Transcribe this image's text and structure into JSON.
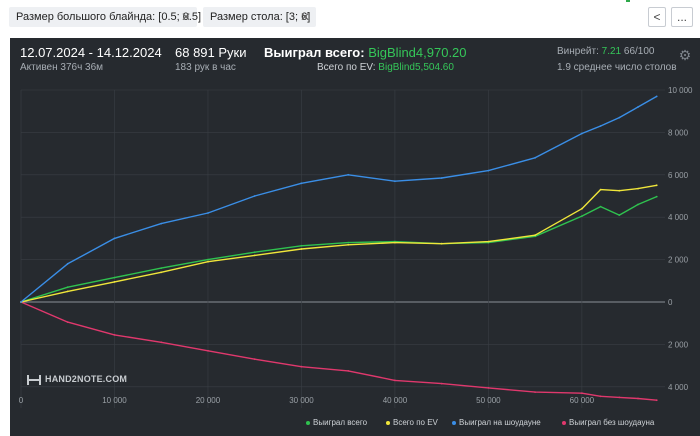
{
  "filters": [
    {
      "label": "Размер большого блайнда: [0.5; 0.5]",
      "close": "✕"
    },
    {
      "label": "Размер стола: [3; 6]",
      "close": "✕"
    }
  ],
  "nav": {
    "back": "<",
    "more": "..."
  },
  "summary": {
    "date_range": "12.07.2024 - 14.12.2024",
    "active": "Активен 376ч 36м",
    "hands": "68 891 Руки",
    "hands_per_hour": "183 рук в час",
    "won_total_label": "Выиграл всего:",
    "won_total_value": "BigBlind4,970.20",
    "ev_total_label": "Всего по EV:",
    "ev_total_value": "BigBlind5,504.60",
    "winrate_label": "Винрейт:",
    "winrate_value": "7.21",
    "winrate_per": "66/100",
    "avg_tables": "1.9 среднее число столов"
  },
  "logo_text": "HAND2NOTE.COM",
  "icons": {
    "settings": "gear-icon",
    "logo": "hand2note-logo-icon"
  },
  "colors": {
    "panel": "#262a2f",
    "green": "#2fc24f",
    "yellow": "#f0e63a",
    "blue": "#3a8ee6",
    "pink": "#e0386d"
  },
  "chart_data": {
    "type": "line",
    "x": [
      0,
      5000,
      10000,
      15000,
      20000,
      25000,
      30000,
      35000,
      40000,
      45000,
      50000,
      55000,
      60000,
      62000,
      64000,
      66000,
      68000
    ],
    "series": [
      {
        "name": "Выиграл всего",
        "values": [
          0,
          700,
          1150,
          1600,
          2000,
          2350,
          2650,
          2800,
          2850,
          2750,
          2800,
          3100,
          4050,
          4500,
          4100,
          4600,
          4970
        ]
      },
      {
        "name": "Всего по EV",
        "values": [
          0,
          500,
          950,
          1400,
          1900,
          2200,
          2500,
          2700,
          2800,
          2750,
          2850,
          3150,
          4400,
          5300,
          5250,
          5350,
          5505
        ]
      },
      {
        "name": "Выиграл на шоудауне",
        "values": [
          0,
          1800,
          3000,
          3700,
          4200,
          5000,
          5600,
          6000,
          5700,
          5850,
          6200,
          6800,
          7950,
          8300,
          8700,
          9200,
          9700
        ]
      },
      {
        "name": "Выиграл без шоудауна",
        "values": [
          0,
          -950,
          -1550,
          -1900,
          -2300,
          -2700,
          -3050,
          -3250,
          -3700,
          -3850,
          -4050,
          -4250,
          -4300,
          -4450,
          -4500,
          -4550,
          -4630
        ]
      }
    ],
    "xticks": [
      0,
      10000,
      20000,
      30000,
      40000,
      50000,
      60000
    ],
    "xtick_labels": [
      "0",
      "10 000",
      "20 000",
      "30 000",
      "40 000",
      "50 000",
      "60 000"
    ],
    "yticks": [
      -4000,
      -2000,
      0,
      2000,
      4000,
      6000,
      8000,
      10000
    ],
    "ytick_labels": [
      "4 000",
      "2 000",
      "0",
      "2 000",
      "4 000",
      "6 000",
      "8 000",
      "10 000"
    ],
    "xlim": [
      0,
      68891
    ],
    "ylim": [
      -5000,
      10000
    ],
    "grid": true,
    "legend_position": "bottom-right"
  }
}
